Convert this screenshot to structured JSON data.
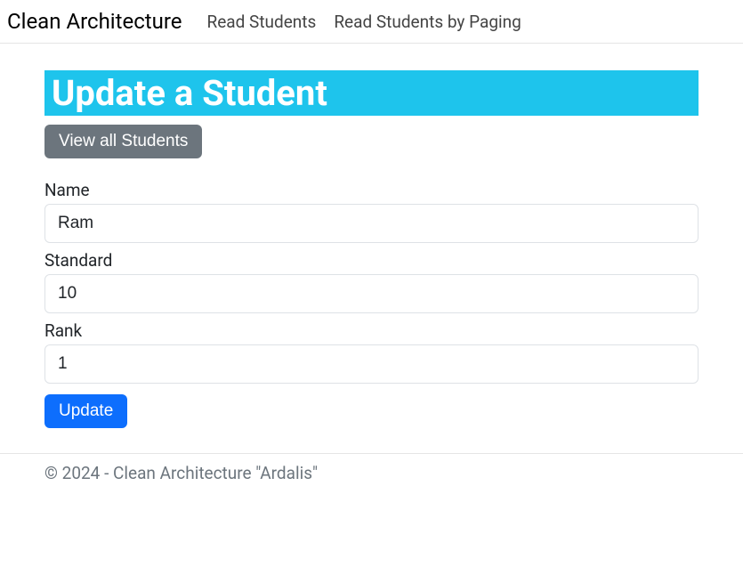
{
  "navbar": {
    "brand": "Clean Architecture",
    "links": [
      "Read Students",
      "Read Students by Paging"
    ]
  },
  "page": {
    "title": "Update a Student",
    "viewAllLabel": "View all Students"
  },
  "form": {
    "fields": [
      {
        "label": "Name",
        "value": "Ram"
      },
      {
        "label": "Standard",
        "value": "10"
      },
      {
        "label": "Rank",
        "value": "1"
      }
    ],
    "submitLabel": "Update"
  },
  "footer": {
    "text": "© 2024 - Clean Architecture \"Ardalis\""
  }
}
